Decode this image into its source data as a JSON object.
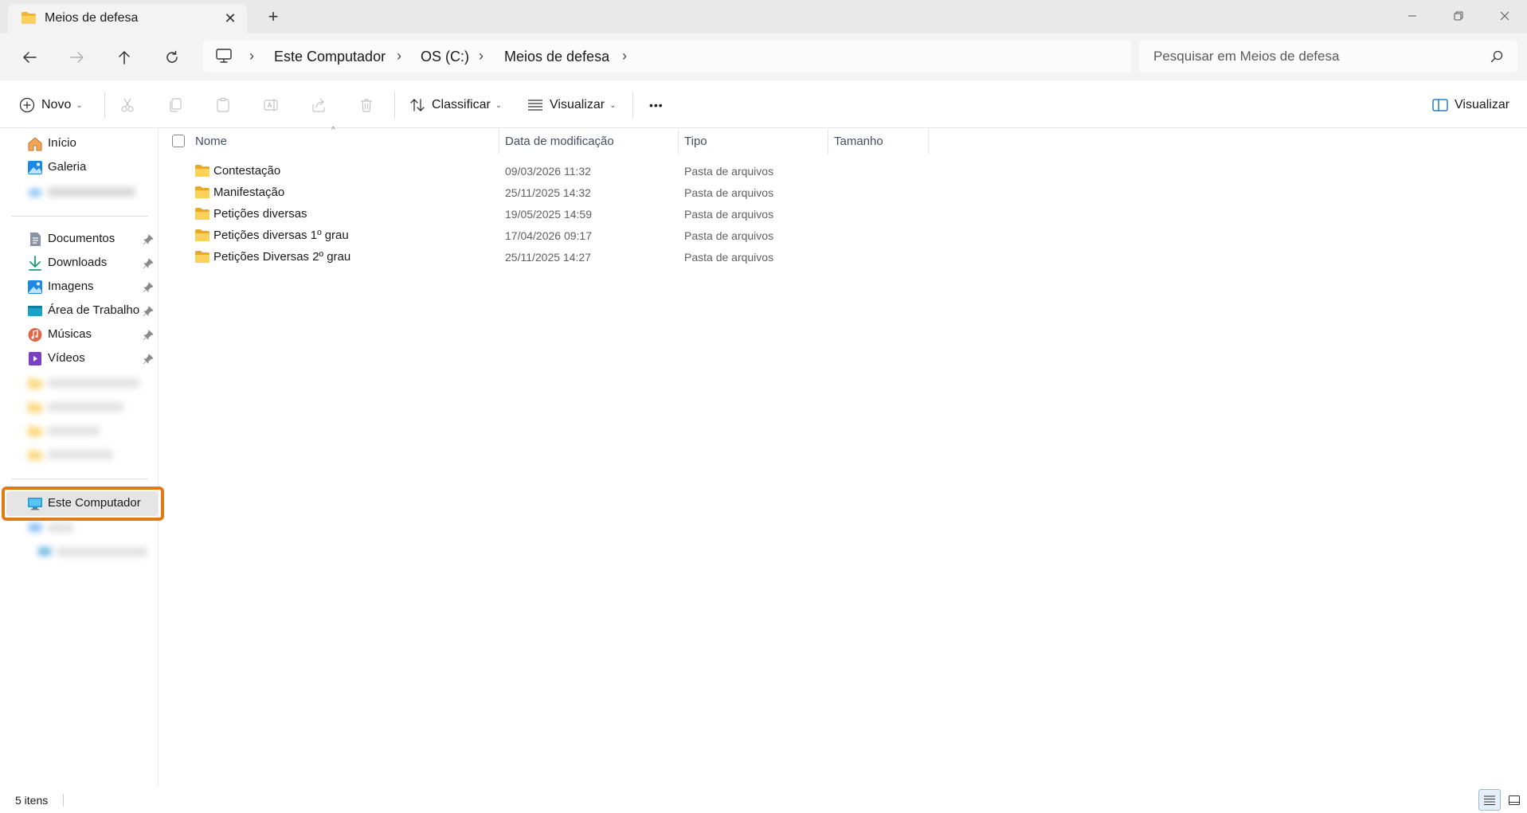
{
  "window": {
    "tab_title": "Meios de defesa",
    "new_tab": "+",
    "close_tab": "✕"
  },
  "address": {
    "crumbs": [
      "Este Computador",
      "OS (C:)",
      "Meios de defesa"
    ],
    "separator": "›"
  },
  "search": {
    "placeholder": "Pesquisar em Meios de defesa"
  },
  "commands": {
    "new_label": "Novo",
    "sort_label": "Classificar",
    "view_label": "Visualizar",
    "more_label": "•••",
    "preview_label": "Visualizar"
  },
  "sidebar": {
    "top": [
      {
        "label": "Início",
        "icon": "home-icon"
      },
      {
        "label": "Galeria",
        "icon": "gallery-icon"
      }
    ],
    "pinned": [
      {
        "label": "Documentos",
        "icon": "documents-icon"
      },
      {
        "label": "Downloads",
        "icon": "downloads-icon"
      },
      {
        "label": "Imagens",
        "icon": "images-icon"
      },
      {
        "label": "Área de Trabalho",
        "icon": "desktop-icon"
      },
      {
        "label": "Músicas",
        "icon": "music-icon"
      },
      {
        "label": "Vídeos",
        "icon": "videos-icon"
      }
    ],
    "this_pc": "Este Computador"
  },
  "columns": {
    "name": "Nome",
    "modified": "Data de modificação",
    "type": "Tipo",
    "size": "Tamanho"
  },
  "files": [
    {
      "name": "Contestação",
      "modified": "09/03/2026 11:32",
      "type": "Pasta de arquivos"
    },
    {
      "name": "Manifestação",
      "modified": "25/11/2025 14:32",
      "type": "Pasta de arquivos"
    },
    {
      "name": "Petições diversas",
      "modified": "19/05/2025 14:59",
      "type": "Pasta de arquivos"
    },
    {
      "name": "Petições diversas 1º grau",
      "modified": "17/04/2026 09:17",
      "type": "Pasta de arquivos"
    },
    {
      "name": "Petições Diversas 2º grau",
      "modified": "25/11/2025 14:27",
      "type": "Pasta de arquivos"
    }
  ],
  "status": {
    "count": "5 itens"
  },
  "colors": {
    "accent": "#0067c0",
    "folder": "#f7c744",
    "highlight": "#e07a14"
  }
}
